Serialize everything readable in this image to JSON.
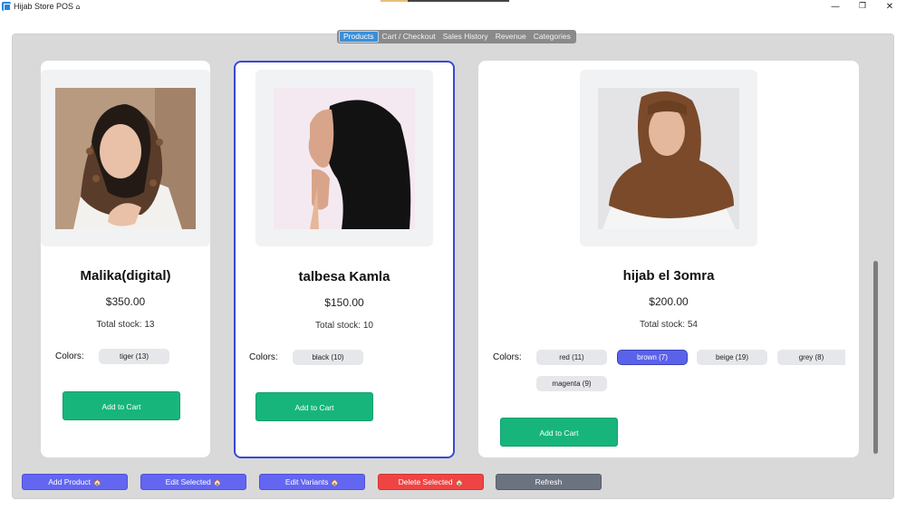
{
  "window": {
    "title": "Hijab Store POS",
    "title_icon": "house-icon",
    "min_glyph": "—",
    "max_glyph": "❐",
    "close_glyph": "✕"
  },
  "tabs": [
    {
      "label": "Products",
      "active": true
    },
    {
      "label": "Cart / Checkout",
      "active": false
    },
    {
      "label": "Sales History",
      "active": false
    },
    {
      "label": "Revenue",
      "active": false
    },
    {
      "label": "Categories",
      "active": false
    }
  ],
  "products": [
    {
      "name": "Malika(digital)",
      "price": "$350.00",
      "stock": "Total stock: 13",
      "colors_label": "Colors:",
      "colors": [
        {
          "label": "tiger (13)",
          "active": false
        }
      ],
      "add_label": "Add to Cart"
    },
    {
      "name": "talbesa Kamla",
      "price": "$150.00",
      "stock": "Total stock: 10",
      "colors_label": "Colors:",
      "colors": [
        {
          "label": "black (10)",
          "active": false
        }
      ],
      "add_label": "Add to Cart"
    },
    {
      "name": "hijab el 3omra",
      "price": "$200.00",
      "stock": "Total stock: 54",
      "colors_label": "Colors:",
      "colors": [
        {
          "label": "red (11)",
          "active": false
        },
        {
          "label": "brown (7)",
          "active": true
        },
        {
          "label": "beige (19)",
          "active": false
        },
        {
          "label": "grey (8)",
          "active": false
        },
        {
          "label": "magenta (9)",
          "active": false
        }
      ],
      "add_label": "Add to Cart"
    }
  ],
  "actions": {
    "add_product": "Add Product",
    "edit_selected": "Edit Selected",
    "edit_variants": "Edit Variants",
    "delete_selected": "Delete Selected",
    "refresh": "Refresh",
    "action_icon": "🏠"
  },
  "colors": {
    "accent_tab": "#3b8ed8",
    "add_to_cart": "#17b57c",
    "primary_button": "#6366f1",
    "danger_button": "#ef4444",
    "neutral_button": "#6b7280",
    "selected_card_border": "#3948d6"
  }
}
